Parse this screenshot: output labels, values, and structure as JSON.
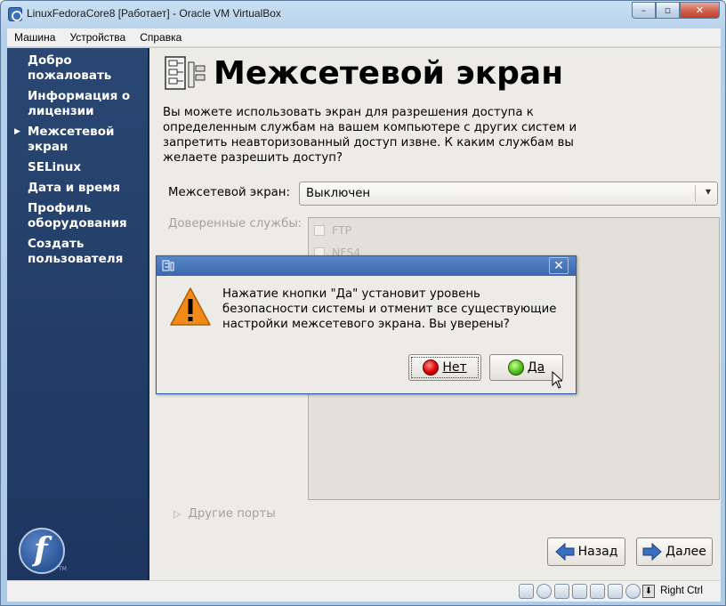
{
  "host": {
    "title": "LinuxFedoraCore8 [Работает] - Oracle VM VirtualBox",
    "menu": [
      "Машина",
      "Устройства",
      "Справка"
    ],
    "controls": {
      "minimize": "–",
      "maximize": "▫",
      "close": "✕"
    },
    "status": {
      "host_key": "Right Ctrl"
    }
  },
  "sidebar": {
    "items": [
      {
        "label": "Добро пожаловать",
        "current": false
      },
      {
        "label": "Информация о лицензии",
        "current": false
      },
      {
        "label": "Межсетевой экран",
        "current": true
      },
      {
        "label": "SELinux",
        "current": false
      },
      {
        "label": "Дата и время",
        "current": false
      },
      {
        "label": "Профиль оборудования",
        "current": false
      },
      {
        "label": "Создать пользователя",
        "current": false
      }
    ],
    "logo_letter": "f",
    "logo_tm": "TM"
  },
  "main": {
    "title": "Межсетевой экран",
    "description": "Вы можете использовать экран для разрешения доступа к определенным службам на вашем компьютере с других систем и запретить неавторизованный доступ извне.  К каким службам вы желаете разрешить доступ?",
    "firewall_label": "Межсетевой экран:",
    "firewall_value": "Выключен",
    "trusted_label": "Доверенные службы:",
    "services": [
      "FTP",
      "NFS4"
    ],
    "other_ports": "Другие порты",
    "back_button": "Назад",
    "next_button": "Далее"
  },
  "dialog": {
    "message": "Нажатие кнопки \"Да\" установит уровень безопасности системы и отменит все существующие настройки межсетевого экрана. Вы уверены?",
    "no_button": "Нет",
    "yes_button": "Да",
    "close": "✕"
  },
  "colors": {
    "sidebar_bg": "#294772",
    "guest_bg": "#edebe7",
    "dialog_titlebar": "#3a67ad",
    "warning": "#f28a1a"
  }
}
